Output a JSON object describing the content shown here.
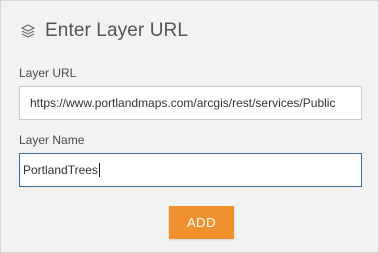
{
  "dialog": {
    "title": "Enter Layer URL",
    "icon": "layers-icon"
  },
  "fields": {
    "url": {
      "label": "Layer URL",
      "value": "https://www.portlandmaps.com/arcgis/rest/services/Public"
    },
    "name": {
      "label": "Layer Name",
      "value": "PortlandTrees"
    }
  },
  "actions": {
    "add_label": "ADD"
  },
  "colors": {
    "panel_bg": "#f2f2f2",
    "accent": "#f0912e",
    "focus_border": "#3e6f98"
  }
}
